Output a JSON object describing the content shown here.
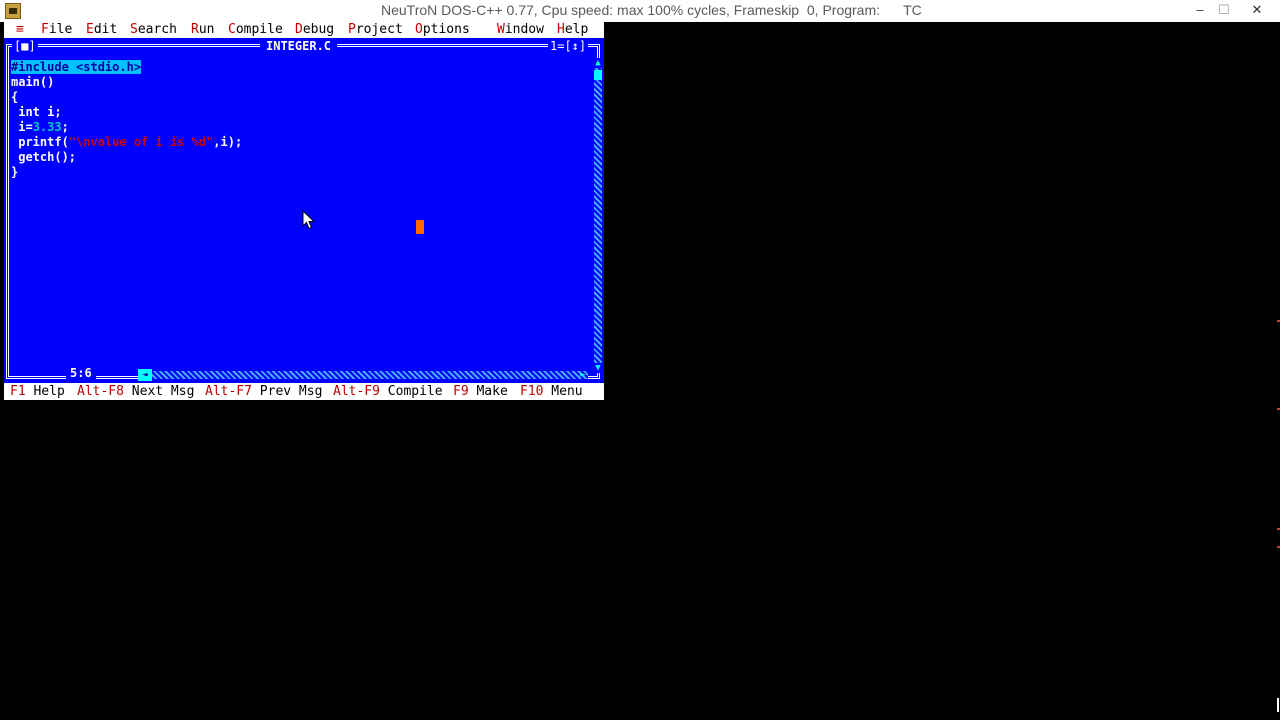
{
  "window": {
    "title": "NeuTroN DOS-C++ 0.77, Cpu speed: max 100% cycles, Frameskip  0, Program:      TC",
    "minimize": "–",
    "maximize": "☐",
    "close": "✕"
  },
  "menubar": {
    "system": "≡",
    "items": [
      {
        "hotkey": "F",
        "rest": "ile"
      },
      {
        "hotkey": "E",
        "rest": "dit"
      },
      {
        "hotkey": "S",
        "rest": "earch"
      },
      {
        "hotkey": "R",
        "rest": "un"
      },
      {
        "hotkey": "C",
        "rest": "ompile"
      },
      {
        "hotkey": "D",
        "rest": "ebug"
      },
      {
        "hotkey": "P",
        "rest": "roject"
      },
      {
        "hotkey": "O",
        "rest": "ptions"
      },
      {
        "hotkey": "W",
        "rest": "indow"
      },
      {
        "hotkey": "H",
        "rest": "elp"
      }
    ]
  },
  "editor": {
    "filename": "INTEGER.C",
    "close_box": "[■]",
    "window_number": "1=[↕]",
    "cursor_position": "5:6",
    "lines": {
      "l1": "#include <stdio.h>",
      "l2": "main()",
      "l3": "{",
      "l4": " int i;",
      "l5a": " i=",
      "l5num": "3.33",
      "l5b": ";",
      "l6a": " printf(",
      "l6str": "\"\\nvalue of i is %d\"",
      "l6b": ",i);",
      "l7": " getch();",
      "l8": "}"
    }
  },
  "statusbar": {
    "items": [
      {
        "key": "F1",
        "label": " Help"
      },
      {
        "key": "Alt-F8",
        "label": " Next Msg"
      },
      {
        "key": "Alt-F7",
        "label": " Prev Msg"
      },
      {
        "key": "Alt-F9",
        "label": " Compile"
      },
      {
        "key": "F9",
        "label": " Make"
      },
      {
        "key": "F10",
        "label": " Menu"
      }
    ]
  },
  "colors": {
    "editor_bg": "#0000ff",
    "menu_bg": "#ffffff",
    "hotkey": "#c00000",
    "string_literal": "#d00000",
    "cursor": "#ff6a00"
  }
}
